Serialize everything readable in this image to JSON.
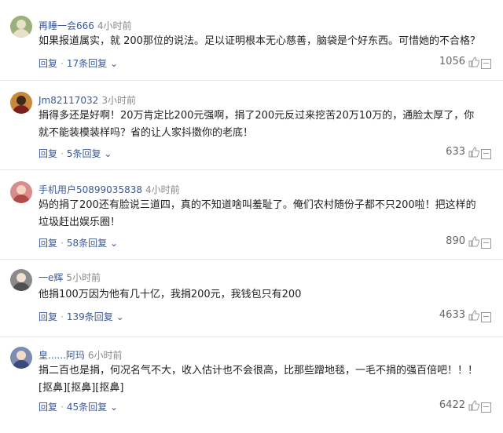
{
  "comments": [
    {
      "user": "再睡一会666",
      "time": "4小时前",
      "text": "如果报道属实，就 200那位的说法。足以证明根本无心慈善，脑袋是个好东西。可惜她的不合格？",
      "reply": "回复",
      "replies": "17条回复",
      "likes": "1056",
      "avatar_color": "#9bb07a"
    },
    {
      "user": "Jm82117032",
      "time": "3小时前",
      "text": "捐得多还是好啊！20万肯定比200元强啊，捐了200元反过来挖苦20万10万的，通脸太厚了，你就不能装模装样吗？省的让人家抖擞你的老底！",
      "reply": "回复",
      "replies": "5条回复",
      "likes": "633",
      "avatar_color": "#c88a3a"
    },
    {
      "user": "手机用户50899035838",
      "time": "4小时前",
      "text": "妈的捐了200还有脸说三道四，真的不知道啥叫羞耻了。俺们农村随份子都不只200啦！把这样的垃圾赶出娱乐圈！",
      "reply": "回复",
      "replies": "58条回复",
      "likes": "890",
      "avatar_color": "#d98c8c"
    },
    {
      "user": "一e辉",
      "time": "5小时前",
      "text": "他捐100万因为他有几十亿，我捐200元，我钱包只有200",
      "reply": "回复",
      "replies": "139条回复",
      "likes": "4633",
      "avatar_color": "#8a8a8a"
    },
    {
      "user": "皇......阿玛",
      "time": "6小时前",
      "text": "捐二百也是捐，何况名气不大，收入估计也不会很高，比那些蹭地毯，一毛不捐的强百倍吧！！！ [抠鼻][抠鼻][抠鼻]",
      "reply": "回复",
      "replies": "45条回复",
      "likes": "6422",
      "avatar_color": "#7d8cb0"
    }
  ]
}
